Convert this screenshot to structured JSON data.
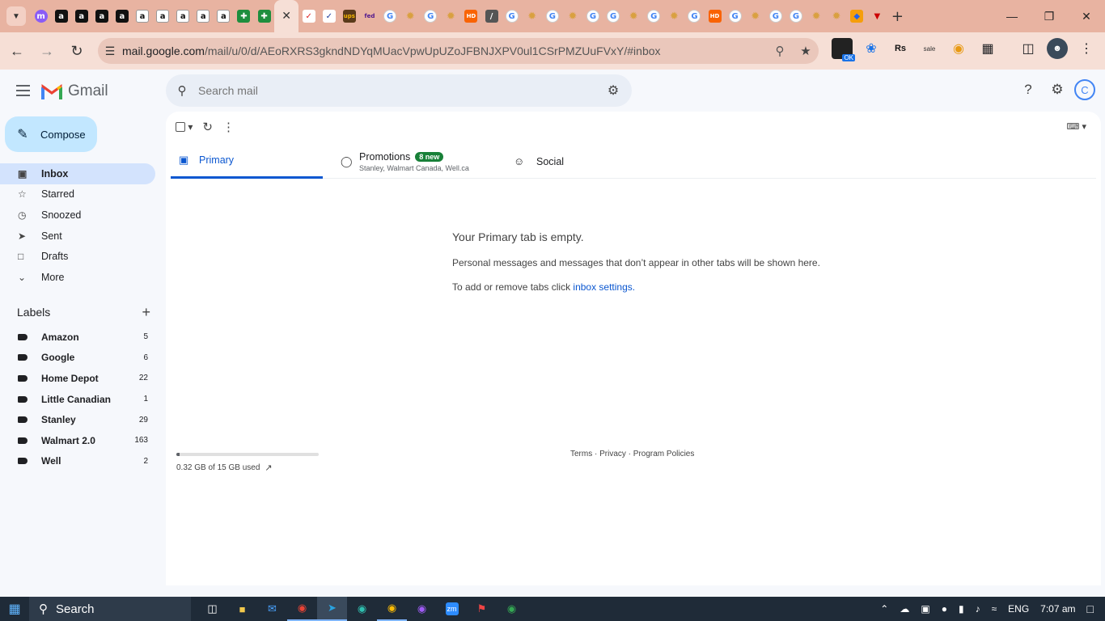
{
  "browser": {
    "url": {
      "host": "mail.google.com",
      "path": "/mail/u/0/d/AEoRXRS3gkndNDYqMUacVpwUpUZoJFBNJXPV0ul1CSrPMZUuFVxY/#inbox"
    },
    "ok_badge": "OK"
  },
  "gmail": {
    "logo_text": "Gmail",
    "search_placeholder": "Search mail",
    "compose_label": "Compose",
    "avatar_initial": "C",
    "nav": [
      {
        "label": "Inbox"
      },
      {
        "label": "Starred"
      },
      {
        "label": "Snoozed"
      },
      {
        "label": "Sent"
      },
      {
        "label": "Drafts"
      },
      {
        "label": "More"
      }
    ],
    "labels_heading": "Labels",
    "labels": [
      {
        "name": "Amazon",
        "count": "5"
      },
      {
        "name": "Google",
        "count": "6"
      },
      {
        "name": "Home Depot",
        "count": "22"
      },
      {
        "name": "Little Canadian",
        "count": "1"
      },
      {
        "name": "Stanley",
        "count": "29"
      },
      {
        "name": "Walmart 2.0",
        "count": "163"
      },
      {
        "name": "Well",
        "count": "2"
      }
    ],
    "tabs": {
      "primary": "Primary",
      "promotions": "Promotions",
      "promotions_badge": "8 new",
      "promotions_senders": "Stanley, Walmart Canada, Well.ca",
      "social": "Social"
    },
    "empty": {
      "title": "Your Primary tab is empty.",
      "body": "Personal messages and messages that don’t appear in other tabs will be shown here.",
      "settings_prefix": "To add or remove tabs click ",
      "settings_link": "inbox settings",
      "settings_suffix": "."
    },
    "storage": {
      "text": "0.32 GB of 15 GB used",
      "fraction": 0.021
    },
    "footer": "Terms · Privacy · Program Policies"
  },
  "taskbar": {
    "search_label": "Search",
    "lang": "ENG",
    "time": "7:07 am"
  }
}
